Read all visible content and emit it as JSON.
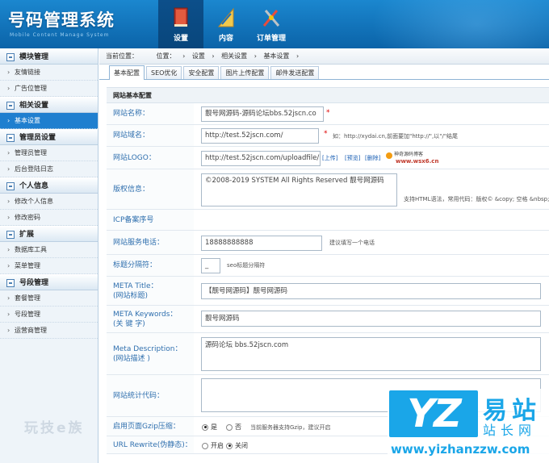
{
  "header": {
    "title": "号码管理系统",
    "subtitle": "Mobile Content Manage System",
    "nav": [
      {
        "label": "设置",
        "icon": "book-icon",
        "active": true
      },
      {
        "label": "内容",
        "icon": "ruler-icon",
        "active": false
      },
      {
        "label": "订单管理",
        "icon": "tools-icon",
        "active": false
      }
    ]
  },
  "sidebar": {
    "groups": [
      {
        "title": "模块管理",
        "items": [
          "友情链接",
          "广告位管理"
        ]
      },
      {
        "title": "相关设置",
        "items": [
          "基本设置"
        ]
      },
      {
        "title": "管理员设置",
        "items": [
          "管理员管理",
          "后台登陆日志"
        ]
      },
      {
        "title": "个人信息",
        "items": [
          "修改个人信息",
          "修改密码"
        ]
      },
      {
        "title": "扩展",
        "items": [
          "数据库工具",
          "菜单管理"
        ]
      },
      {
        "title": "号段管理",
        "items": [
          "套餐管理",
          "号段管理",
          "运营商管理"
        ]
      }
    ],
    "active_item": "基本设置"
  },
  "breadcrumb": {
    "label": "当前位置：",
    "loc": "位置：",
    "items": [
      "设置",
      "相关设置",
      "基本设置"
    ]
  },
  "tabs": [
    "基本配置",
    "SEO优化",
    "安全配置",
    "图片上传配置",
    "邮件发送配置"
  ],
  "form": {
    "section_title": "网站基本配置",
    "site_name": {
      "label": "网站名称：",
      "value": "靓号网源码-源码论坛bbs.52jscn.co"
    },
    "site_domain": {
      "label": "网站域名：",
      "value": "http://test.52jscn.com/",
      "hint": "如：http://xydai.cn,前面要加\"http://\",以\"/\"结尾"
    },
    "site_logo": {
      "label": "网站LOGO：",
      "value": "http://test.52jscn.com/uploadfile/",
      "upload": "[上传]",
      "preview": "[预览]",
      "delete": "[删除]",
      "preview_text": "神奇源码博客",
      "preview_url": "www.wsx6.cn"
    },
    "copyright": {
      "label": "版权信息：",
      "value": "©2008-2019 SYSTEM All Rights Reserved  靓号网源码",
      "hint": "支持HTML语法，常用代码：版权© &copy; 空格 &nbsp;"
    },
    "icp": {
      "label": "ICP备案序号",
      "value": ""
    },
    "phone": {
      "label": "网站服务电话：",
      "value": "18888888888",
      "hint": "建议填写一个电话"
    },
    "separator": {
      "label": "标题分隔符：",
      "value": "_",
      "hint": "seo标题分隔符"
    },
    "meta_title": {
      "label1": "META Title：",
      "label2": "(网站标题)",
      "value": "【靓号网源码】靓号网源码"
    },
    "meta_keywords": {
      "label1": "META Keywords：",
      "label2": "(关 键 字)",
      "value": "靓号网源码"
    },
    "meta_description": {
      "label1": "Meta Description：",
      "label2": "(网站描述 )",
      "value": "源码论坛 bbs.52jscn.com"
    },
    "stat_code": {
      "label": "网站统计代码：",
      "value": ""
    },
    "gzip": {
      "label": "启用页面Gzip压缩：",
      "yes": "是",
      "no": "否",
      "hint": "当前服务器支持Gzip，建议开启"
    },
    "rewrite": {
      "label": "URL Rewrite(伪静态)：",
      "on": "开启",
      "off": "关闭"
    }
  },
  "watermark": {
    "letters": "YZ",
    "cn1": "易站",
    "cn2": "站长网",
    "url": "www.yizhanzzw.com",
    "ghost": "玩技e族"
  },
  "colors": {
    "header": "#0b63a8",
    "accent": "#1f7fcf",
    "label": "#2f6fae",
    "watermark": "#1aa6e8"
  }
}
